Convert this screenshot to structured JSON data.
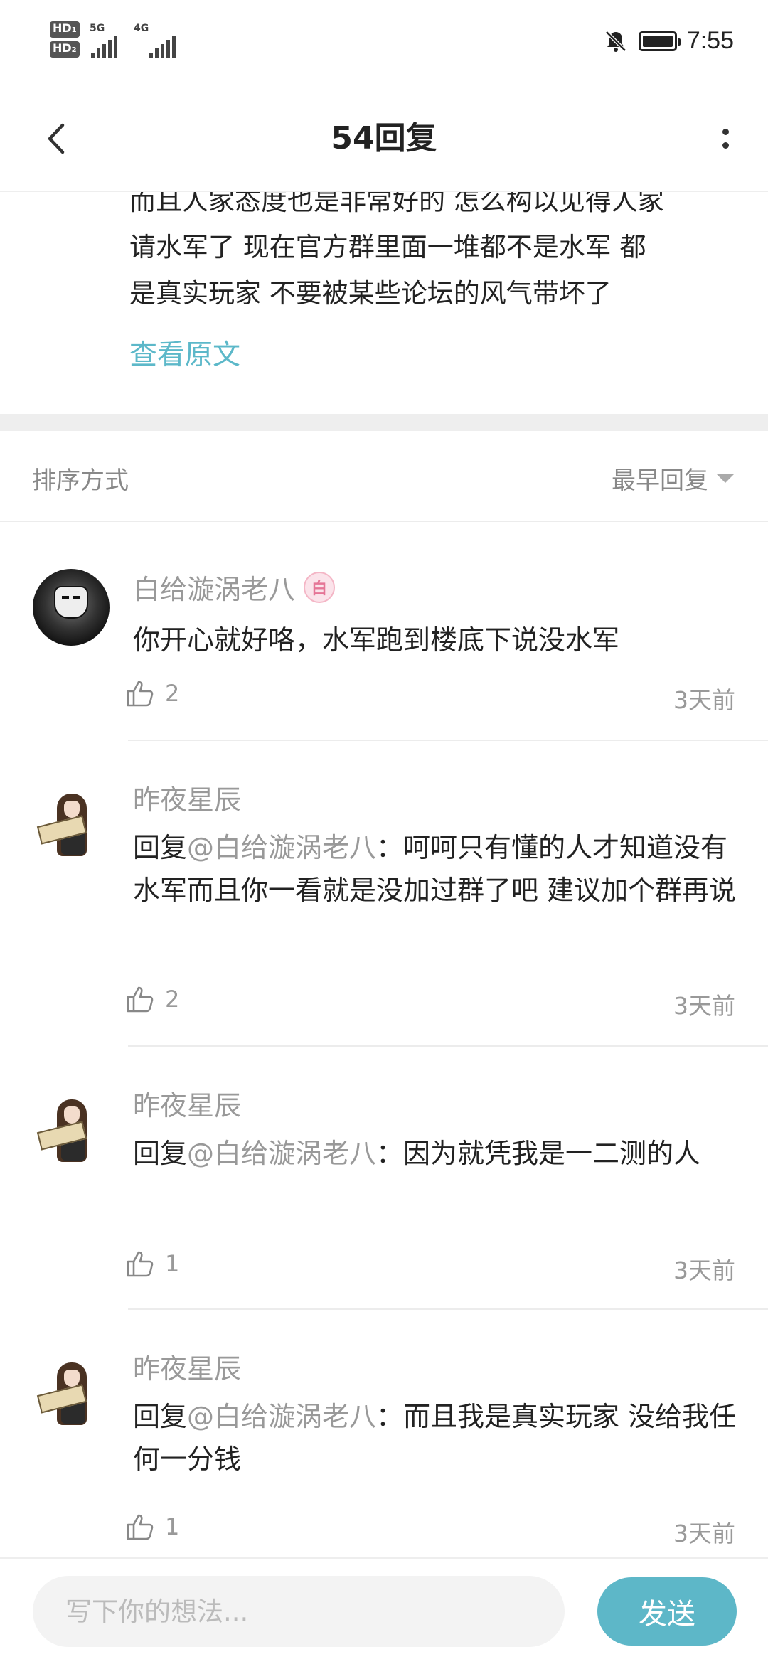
{
  "status_bar": {
    "sim1": "HD",
    "sim1_index": "1",
    "sim2": "HD",
    "sim2_index": "2",
    "net1": "5G",
    "net2": "4G",
    "time": "7:55"
  },
  "header": {
    "title": "54回复"
  },
  "original_post": {
    "lines": [
      "而且人家态度也是非常好的 怎么构以见得人家",
      "请水军了 现在官方群里面一堆都不是水军 都",
      "是真实玩家 不要被某些论坛的风气带坏了"
    ],
    "view_original_label": "查看原文"
  },
  "sort": {
    "label": "排序方式",
    "selected": "最早回复"
  },
  "comments": [
    {
      "username": "白给漩涡老八",
      "badge": "白",
      "prefix": "",
      "mention": "",
      "text": "你开心就好咯，水军跑到楼底下说没水军",
      "likes": "2",
      "time": "3天前"
    },
    {
      "username": "昨夜星辰",
      "prefix": "回复",
      "mention": "@白给漩涡老八",
      "text": "：呵呵只有懂的人才知道没有水军而且你一看就是没加过群了吧 建议加个群再说",
      "likes": "2",
      "time": "3天前"
    },
    {
      "username": "昨夜星辰",
      "prefix": "回复",
      "mention": "@白给漩涡老八",
      "text": "：因为就凭我是一二测的人",
      "likes": "1",
      "time": "3天前"
    },
    {
      "username": "昨夜星辰",
      "prefix": "回复",
      "mention": "@白给漩涡老八",
      "text": "：而且我是真实玩家 没给我任何一分钱",
      "likes": "1",
      "time": "3天前"
    }
  ],
  "input": {
    "placeholder": "写下你的想法...",
    "send_label": "发送"
  },
  "colors": {
    "accent": "#5db7c8",
    "link": "#5cb8c9",
    "muted_text": "#999999"
  }
}
